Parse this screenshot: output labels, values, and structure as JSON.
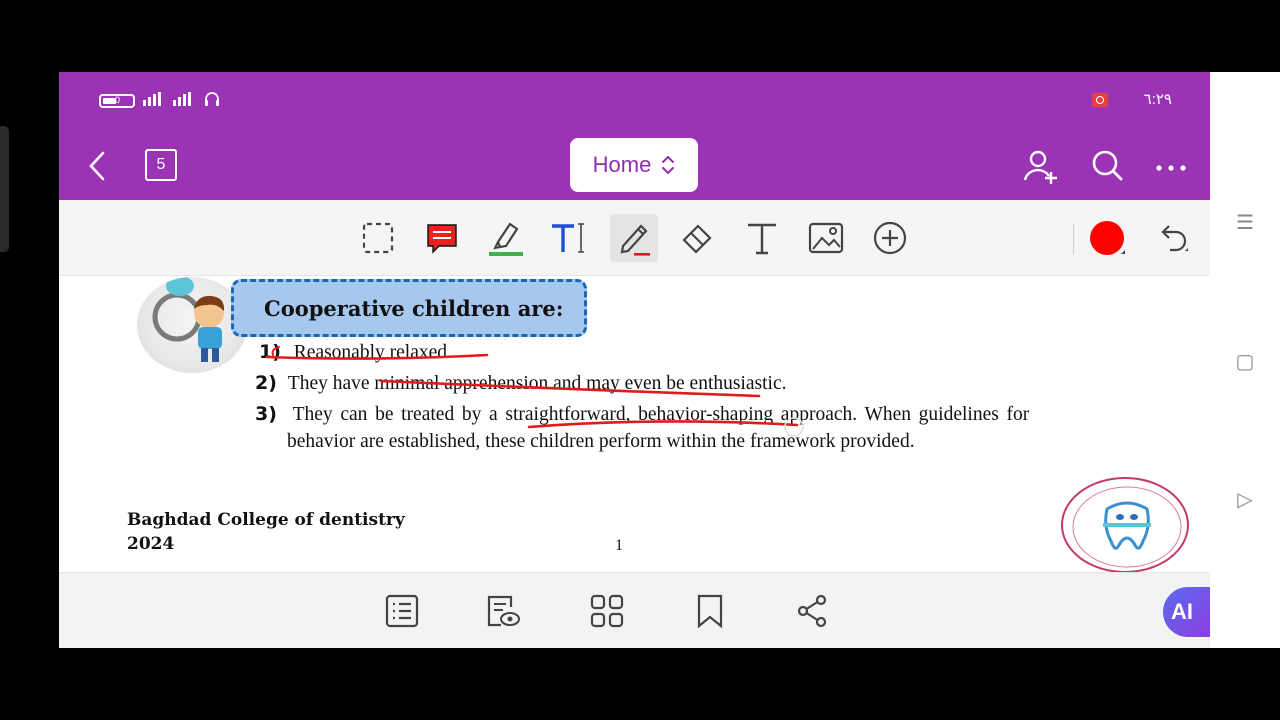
{
  "status_bar": {
    "battery_level": "0",
    "time": "٦:٢٩"
  },
  "nav": {
    "page_count": "5",
    "mode_label": "Home"
  },
  "toolbar": {
    "tools": [
      "selection-icon",
      "comment-icon",
      "highlighter-icon",
      "text-markup-icon",
      "pen-icon",
      "eraser-icon",
      "text-icon",
      "image-icon",
      "add-icon"
    ],
    "active_tool": "pen-icon",
    "pen_color": "#ff0000"
  },
  "document": {
    "title": "Cooperative children are:",
    "items": [
      {
        "num": "1)",
        "text": "Reasonably relaxed."
      },
      {
        "num": "2)",
        "text": "They have minimal apprehension and may even be enthusiastic."
      },
      {
        "num": "3)",
        "text": "They can be treated by a straightforward, behavior-shaping approach. When guidelines for",
        "text2": "behavior are established, these children perform within the framework provided."
      }
    ],
    "footer_college": "Baghdad College of dentistry",
    "footer_year": "2024",
    "page_number": "1"
  },
  "bottom_bar": {
    "ai_label": "AI"
  },
  "colors": {
    "header_purple": "#9b33b5",
    "title_box": "#a6c8ee",
    "ink_red": "#e01b1b"
  }
}
